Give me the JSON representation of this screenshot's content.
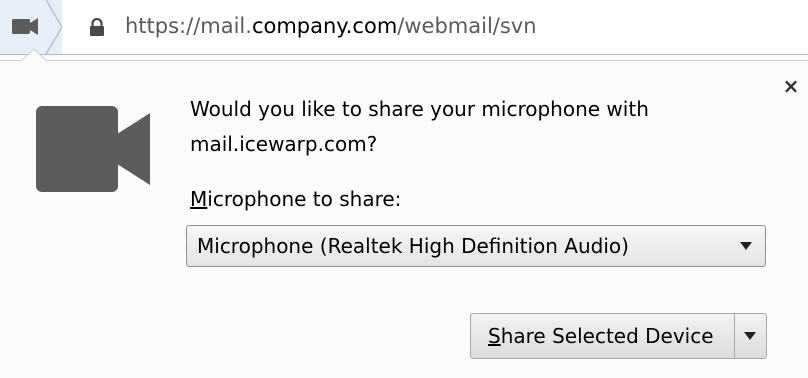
{
  "urlbar": {
    "identity_icon": "camera-icon",
    "lock_icon": "lock-icon",
    "url_prefix": "https://mail.",
    "url_domain": "company.com",
    "url_path": "/webmail/svn"
  },
  "prompt": {
    "icon": "video-camera-icon",
    "close_glyph": "×",
    "message": "Would you like to share your microphone with mail.icewarp.com?",
    "device_label_accesskey": "M",
    "device_label_rest": "icrophone to share:",
    "device_selected": "Microphone (Realtek High Definition Audio)",
    "share_accesskey": "S",
    "share_rest": "hare Selected Device"
  },
  "colors": {
    "icon_gray": "#5c5c5c",
    "url_domain": "#000000",
    "url_dim": "#5a5a5a"
  }
}
